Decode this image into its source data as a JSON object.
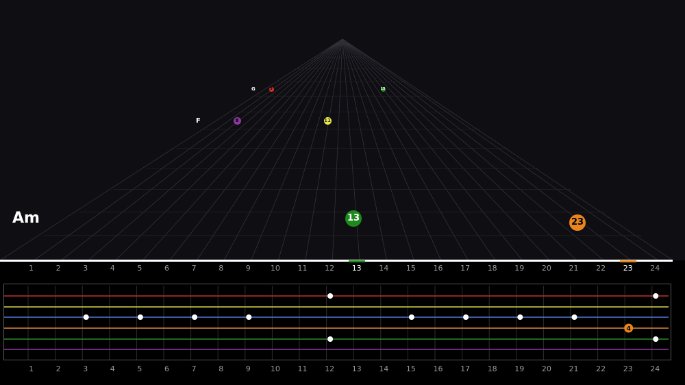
{
  "chord": {
    "name": "Am"
  },
  "fret_numbers": [
    "1",
    "2",
    "3",
    "4",
    "5",
    "6",
    "7",
    "8",
    "9",
    "10",
    "11",
    "12",
    "13",
    "14",
    "15",
    "16",
    "17",
    "18",
    "19",
    "20",
    "21",
    "22",
    "23",
    "24"
  ],
  "highlighted_frets": [
    "13",
    "23"
  ],
  "colors": {
    "string_1": "#c0302a",
    "string_2": "#d8d84a",
    "string_3": "#4c7ad8",
    "string_4": "#e0883a",
    "string_5": "#2a8a2a",
    "string_6": "#8a3aa0",
    "note_red": "#e0302a",
    "note_green": "#1e8a1e",
    "note_orange": "#e8851e",
    "note_purple": "#8a3aa0",
    "note_yellow": "#e8e84a"
  },
  "highway_notes": [
    {
      "label": "13",
      "color": "note_green"
    },
    {
      "label": "23",
      "color": "note_orange"
    },
    {
      "label": "11",
      "color": "note_yellow"
    },
    {
      "label": "8",
      "color": "note_purple"
    },
    {
      "label": "5",
      "color": "note_red"
    },
    {
      "label": "15",
      "color": "note_green"
    }
  ],
  "highway_letters": [
    {
      "label": "F"
    },
    {
      "label": "G"
    }
  ],
  "fret_markers": [
    {
      "string": 1,
      "fret": "12"
    },
    {
      "string": 1,
      "fret": "24"
    },
    {
      "string": 3,
      "fret": "3"
    },
    {
      "string": 3,
      "fret": "5"
    },
    {
      "string": 3,
      "fret": "7"
    },
    {
      "string": 3,
      "fret": "9"
    },
    {
      "string": 3,
      "fret": "15"
    },
    {
      "string": 3,
      "fret": "17"
    },
    {
      "string": 3,
      "fret": "19"
    },
    {
      "string": 3,
      "fret": "21"
    },
    {
      "string": 5,
      "fret": "12"
    },
    {
      "string": 5,
      "fret": "24"
    }
  ],
  "fretboard_note": {
    "label": "4",
    "fret": "23",
    "string": 4,
    "color": "note_orange"
  }
}
